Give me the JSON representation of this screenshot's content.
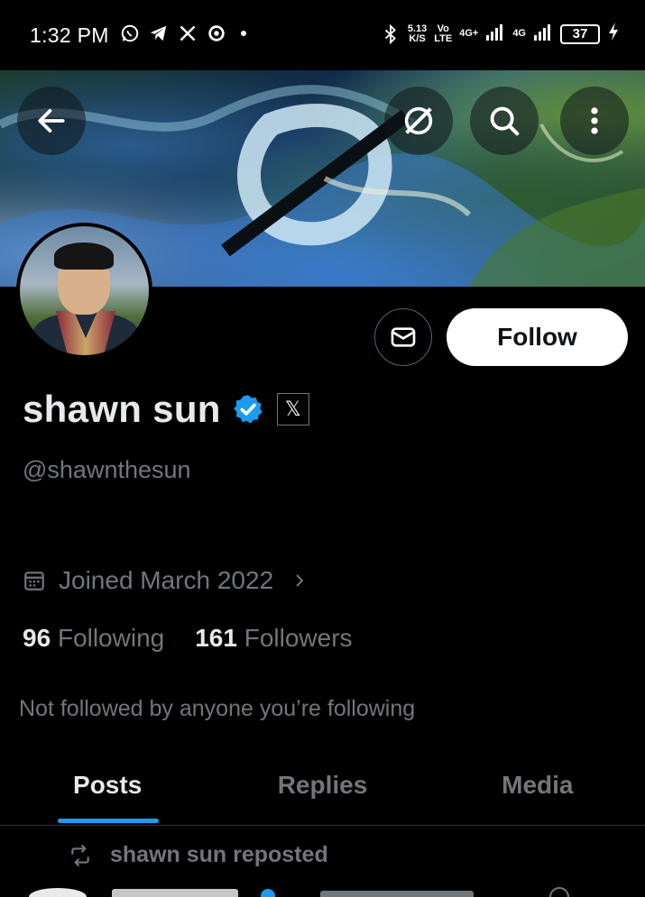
{
  "status_bar": {
    "time": "1:32 PM",
    "speed_value": "5.13",
    "speed_unit": "K/S",
    "volte_top": "Vo",
    "volte_bottom": "LTE",
    "net1": "4G+",
    "net2": "4G",
    "battery": "37",
    "icons_left": [
      "whatsapp-icon",
      "telegram-icon",
      "x-icon",
      "threads-icon"
    ]
  },
  "header": {
    "buttons": [
      "back-arrow-icon",
      "grok-icon",
      "search-icon",
      "more-vertical-icon"
    ]
  },
  "profile": {
    "display_name": "shawn sun",
    "handle": "@shawnthesun",
    "joined": "Joined March 2022",
    "following_count": "96",
    "following_label": "Following",
    "followers_count": "161",
    "followers_label": "Followers",
    "mutual_note": "Not followed by anyone you’re following",
    "x_badge": "𝕏"
  },
  "actions": {
    "follow_label": "Follow"
  },
  "tabs": [
    {
      "label": "Posts",
      "active": true
    },
    {
      "label": "Replies",
      "active": false
    },
    {
      "label": "Media",
      "active": false
    }
  ],
  "feed": {
    "repost_label": "shawn sun reposted"
  },
  "colors": {
    "accent": "#1d9bf0",
    "muted": "#71767b",
    "text": "#e7e9ea",
    "background": "#000000"
  }
}
